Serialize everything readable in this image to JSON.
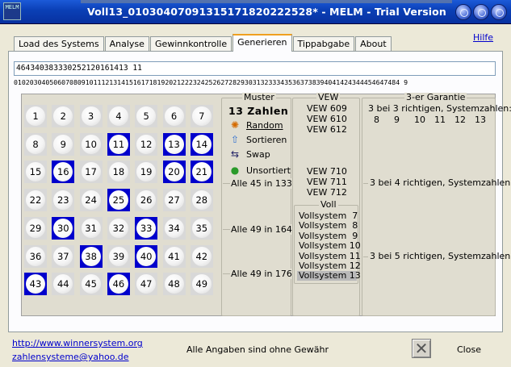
{
  "window": {
    "title": "Voll13_01030407091315171820222528* - MELM - Trial Version",
    "icon": "app-logo-icon",
    "buttons": [
      "minimize-icon",
      "maximize-icon",
      "close-icon"
    ]
  },
  "tabs": [
    {
      "label": "Load des Systems",
      "active": false
    },
    {
      "label": "Analyse",
      "active": false
    },
    {
      "label": "Gewinnkontrolle",
      "active": false
    },
    {
      "label": "Generieren",
      "active": true
    },
    {
      "label": "Tippabgabe",
      "active": false
    },
    {
      "label": "About",
      "active": false
    }
  ],
  "help_link": "Hilfe",
  "combination_input": "464340383330252120161413 11",
  "combination_line": "0102030405060708091011121314151617181920212223242526272829303132333435363738394041424344454647484 9",
  "numbers": [
    1,
    2,
    3,
    4,
    5,
    6,
    7,
    8,
    9,
    10,
    11,
    12,
    13,
    14,
    15,
    16,
    17,
    18,
    19,
    20,
    21,
    22,
    23,
    24,
    25,
    26,
    27,
    28,
    29,
    30,
    31,
    32,
    33,
    34,
    35,
    36,
    37,
    38,
    39,
    40,
    41,
    42,
    43,
    44,
    45,
    46,
    47,
    48,
    49
  ],
  "selected_numbers": [
    11,
    13,
    14,
    16,
    20,
    21,
    25,
    30,
    33,
    38,
    40,
    43,
    46
  ],
  "muster": {
    "label": "Muster",
    "count_text": "13 Zahlen",
    "buttons": [
      {
        "label": "Random",
        "icon": "dice-icon"
      },
      {
        "label": "Sortieren",
        "icon": "arrow-up-icon"
      },
      {
        "label": "Swap",
        "icon": "swap-icon"
      },
      {
        "label": "Unsortiert",
        "icon": "green-circle-icon"
      }
    ],
    "options": [
      "Alle 45 in 133",
      "Alle 49 in 164",
      "Alle 49 in 176"
    ]
  },
  "vew": {
    "label": "VEW",
    "items_top": [
      "VEW 609",
      "VEW 610",
      "VEW 612"
    ],
    "items_bottom": [
      "VEW 710",
      "VEW 711",
      "VEW 712"
    ]
  },
  "voll": {
    "label": "Voll",
    "items": [
      "Vollsystem  7",
      "Vollsystem  8",
      "Vollsystem  9",
      "Vollsystem 10",
      "Vollsystem 11",
      "Vollsystem 12",
      "Vollsystem 13"
    ],
    "selected_index": 6
  },
  "garantie": {
    "label": "3-er Garantie",
    "row1": "3 bei 3 richtigen, Systemzahlen:",
    "row1_numbers": [
      "8",
      "9",
      "10",
      "11",
      "12",
      "13"
    ],
    "row2": "3 bei 4 richtigen, Systemzahlen:",
    "row3": "3 bei 5 richtigen, Systemzahlen:"
  },
  "footer": {
    "website": "http://www.winnersystem.org",
    "email": "zahlensysteme@yahoo.de",
    "disclaimer": "Alle Angaben sind ohne Gewähr",
    "close_label": "Close"
  },
  "colors": {
    "title_bar": "#0a3fb5",
    "selected_cell": "#0000cc",
    "tab_highlight": "#f0a020",
    "link": "#0000cc"
  }
}
